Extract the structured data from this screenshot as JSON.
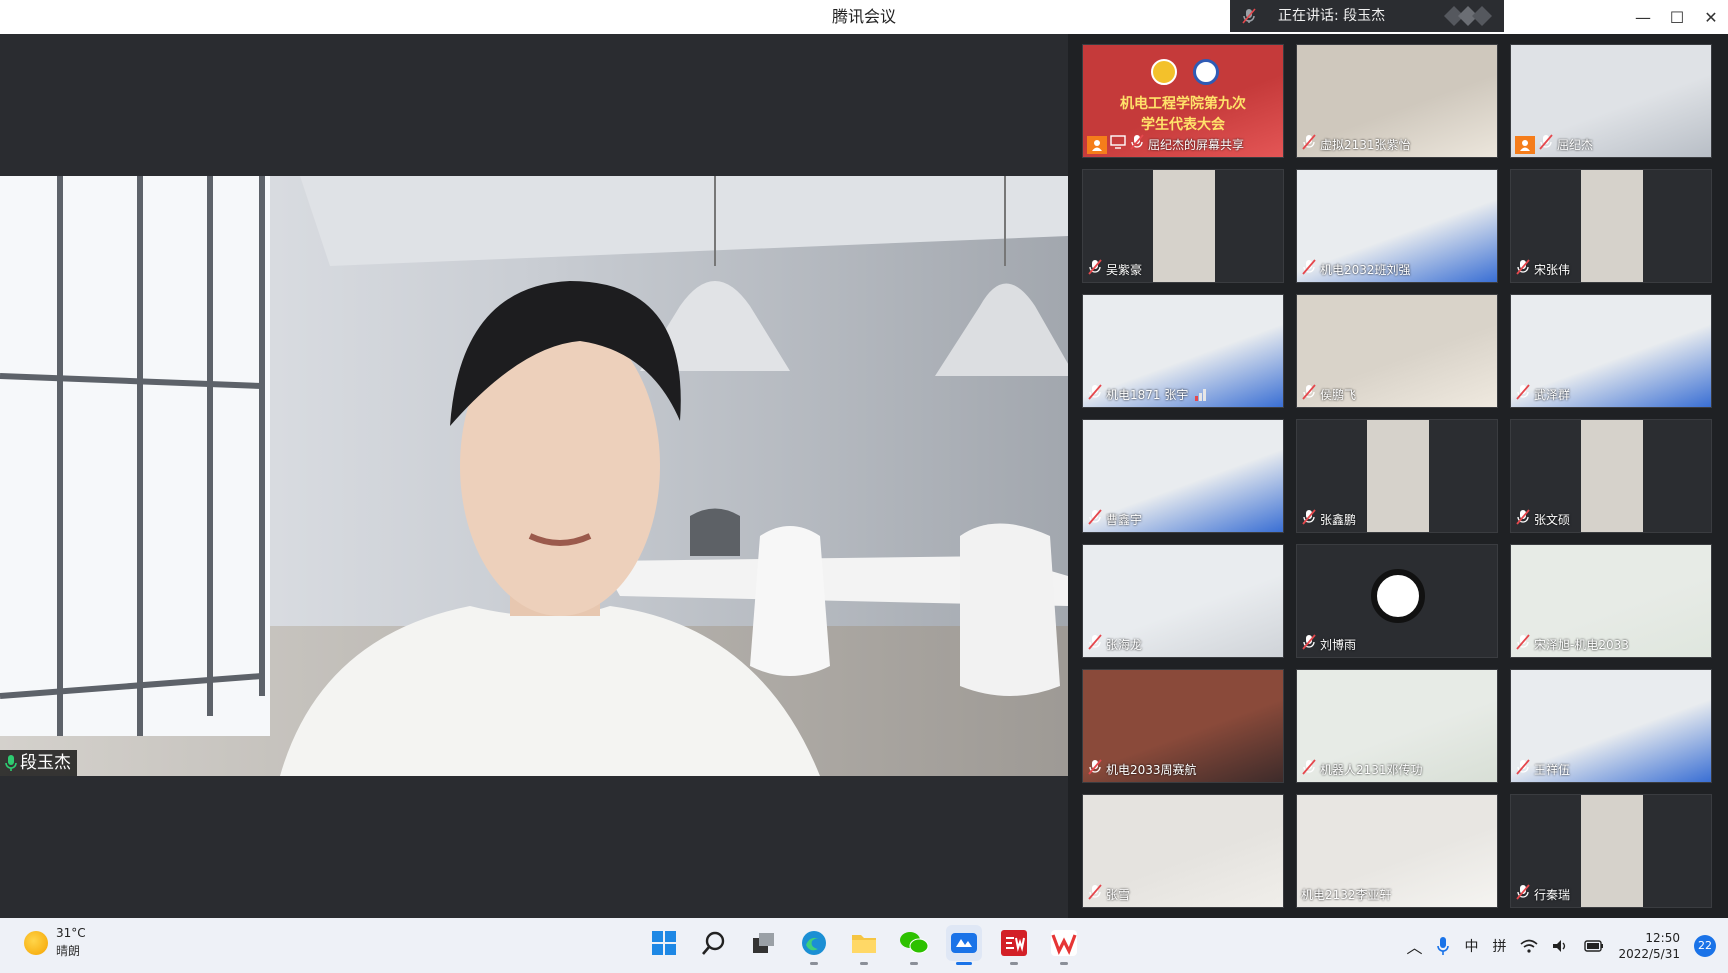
{
  "window": {
    "title": "腾讯会议"
  },
  "speaking": {
    "prefix": "正在讲话: ",
    "name": "段玉杰"
  },
  "window_controls": {
    "minimize": "—",
    "maximize": "☐",
    "close": "✕"
  },
  "main_video": {
    "speaker_name": "段玉杰"
  },
  "gallery": {
    "tiles": [
      {
        "name": "屈纪杰的屏幕共享",
        "banner_line1": "机电工程学院第九次",
        "banner_line2": "学生代表大会"
      },
      {
        "name": "虚拟2131张紫怡"
      },
      {
        "name": "屈纪杰"
      },
      {
        "name": "吴紫豪"
      },
      {
        "name": "机电2032班刘强"
      },
      {
        "name": "宋张伟"
      },
      {
        "name": "机电1871 张宇"
      },
      {
        "name": "侯鹏飞"
      },
      {
        "name": "武泽群"
      },
      {
        "name": "曹鑫宇"
      },
      {
        "name": "张鑫鹏"
      },
      {
        "name": "张文硕"
      },
      {
        "name": "张海龙"
      },
      {
        "name": "刘博雨"
      },
      {
        "name": "宋泽旭-机电2033"
      },
      {
        "name": "机电2033周赛航"
      },
      {
        "name": "机器人2131邓传功"
      },
      {
        "name": "王祥伍"
      },
      {
        "name": "张雪"
      },
      {
        "name": "机电2132李亚轩"
      },
      {
        "name": "行秦瑞"
      }
    ]
  },
  "taskbar": {
    "weather_temp": "31°C",
    "weather_desc": "晴朗",
    "ime_lang": "中",
    "ime_mode": "拼",
    "time": "12:50",
    "date": "2022/5/31",
    "notifications": "22"
  },
  "colors": {
    "accent": "#1a73e8",
    "muted_red": "#e5484d",
    "orange": "#f57d1b"
  }
}
